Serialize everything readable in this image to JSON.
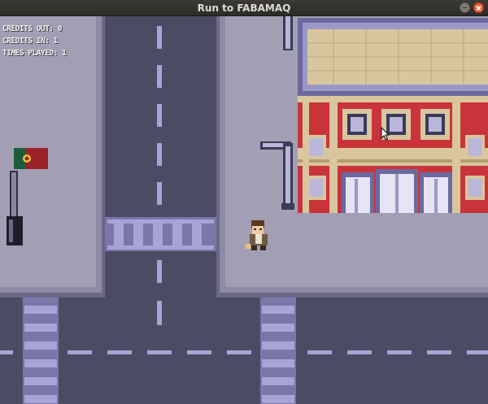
{
  "window": {
    "title": "Run to FABAMAQ"
  },
  "hud": {
    "credits_out": "CREDITS OUT: 0",
    "credits_in": "CREDITS IN: 1",
    "times_played": "TIMES PLAYED: 1"
  },
  "colors": {
    "road": "#4b4b63",
    "sidewalk": "#a29fb4",
    "road_marking": "#a7a4d6",
    "building_brick": "#c9343b",
    "building_roof": "#d9c69f",
    "title_close": "#e9562e"
  },
  "icons": [
    "close-icon",
    "minimize-icon",
    "mouse-cursor-icon",
    "flag-icon"
  ]
}
